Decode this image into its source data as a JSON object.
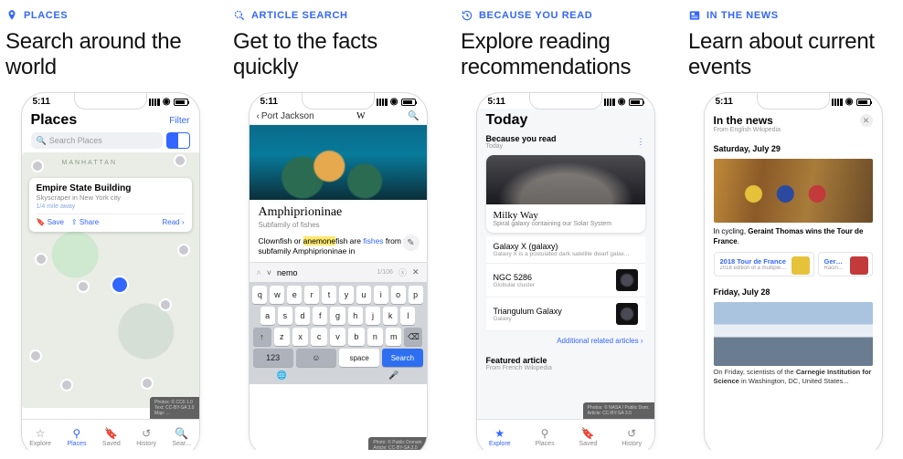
{
  "shared": {
    "statusTime": "5:11"
  },
  "panels": [
    {
      "tag": "PLACES",
      "headline": "Search around the world",
      "places": {
        "title": "Places",
        "filter": "Filter",
        "searchPlaceholder": "Search Places",
        "labelManhattan": "MANHATTAN",
        "callout": {
          "title": "Empire State Building",
          "subtitle": "Skyscraper in New York city",
          "distance": "1/4 mile away",
          "save": "Save",
          "share": "Share",
          "read": "Read"
        },
        "attr": {
          "l1": "Photos: © CC0 1.0",
          "l2": "Text: CC-BY-SA 3.0",
          "l3": "Map: ..."
        }
      },
      "tabs": [
        "Explore",
        "Places",
        "Saved",
        "History",
        "Sear..."
      ]
    },
    {
      "tag": "ARTICLE SEARCH",
      "headline": "Get to the facts quickly",
      "article": {
        "back": "Port Jackson",
        "title": "Amphiprioninae",
        "subtitle": "Subfamily of fishes",
        "body_pre": "Clownfish or ",
        "body_hl": "anemone",
        "body_post": "fish are ",
        "body_link": "fishes",
        "body_tail": " from the subfamily Amphiprioninae in",
        "find_term": "nemo",
        "find_count": "1/106",
        "attr": {
          "l1": "Photo: © Public Domain",
          "l2": "Article: CC-BY-SA 3.0"
        }
      },
      "keyboard": {
        "rows": [
          [
            "q",
            "w",
            "e",
            "r",
            "t",
            "y",
            "u",
            "i",
            "o",
            "p"
          ],
          [
            "a",
            "s",
            "d",
            "f",
            "g",
            "h",
            "j",
            "k",
            "l"
          ],
          [
            "↑",
            "z",
            "x",
            "c",
            "v",
            "b",
            "n",
            "m",
            "⌫"
          ]
        ],
        "num": "123",
        "space": "space",
        "search": "Search"
      }
    },
    {
      "tag": "BECAUSE YOU READ",
      "headline": "Explore reading recommendations",
      "explore": {
        "title": "Today",
        "section": "Because you read",
        "sectionSub": "Today",
        "card": {
          "title": "Milky Way",
          "subtitle": "Spiral galaxy containing our Solar System"
        },
        "items": [
          {
            "t": "Galaxy X (galaxy)",
            "s": "Galaxy X is a postulated dark satellite dwarf galax..."
          },
          {
            "t": "NGC 5286",
            "s": "Globular cluster"
          },
          {
            "t": "Triangulum Galaxy",
            "s": "Galaxy"
          }
        ],
        "more": "Additional related articles",
        "featured": "Featured article",
        "featuredSub": "From French Wikipedia",
        "attr": {
          "l1": "Photos: © NASA / Public Dom.",
          "l2": "Article: CC-BY-SA 3.0"
        }
      },
      "tabs": [
        "Explore",
        "Places",
        "Saved",
        "History"
      ]
    },
    {
      "tag": "IN THE NEWS",
      "headline": "Learn about current events",
      "news": {
        "title": "In the news",
        "subtitle": "From English Wikipedia",
        "day1": "Saturday, July 29",
        "caption1_pre": "In cycling, ",
        "caption1_b": "Geraint Thomas wins the Tour de France",
        "caption1_post": ".",
        "rel1": {
          "t": "2018 Tour de France",
          "s": "2018 edition of a multiple-s..."
        },
        "rel2": {
          "t": "Geraint Tho",
          "s": "Racing cyclist"
        },
        "day2": "Friday, July 28",
        "body2_pre": "On Friday, scientists of the ",
        "body2_b": "Carnegie Institution for Science",
        "body2_post": " in Washington, DC, United States..."
      }
    }
  ]
}
